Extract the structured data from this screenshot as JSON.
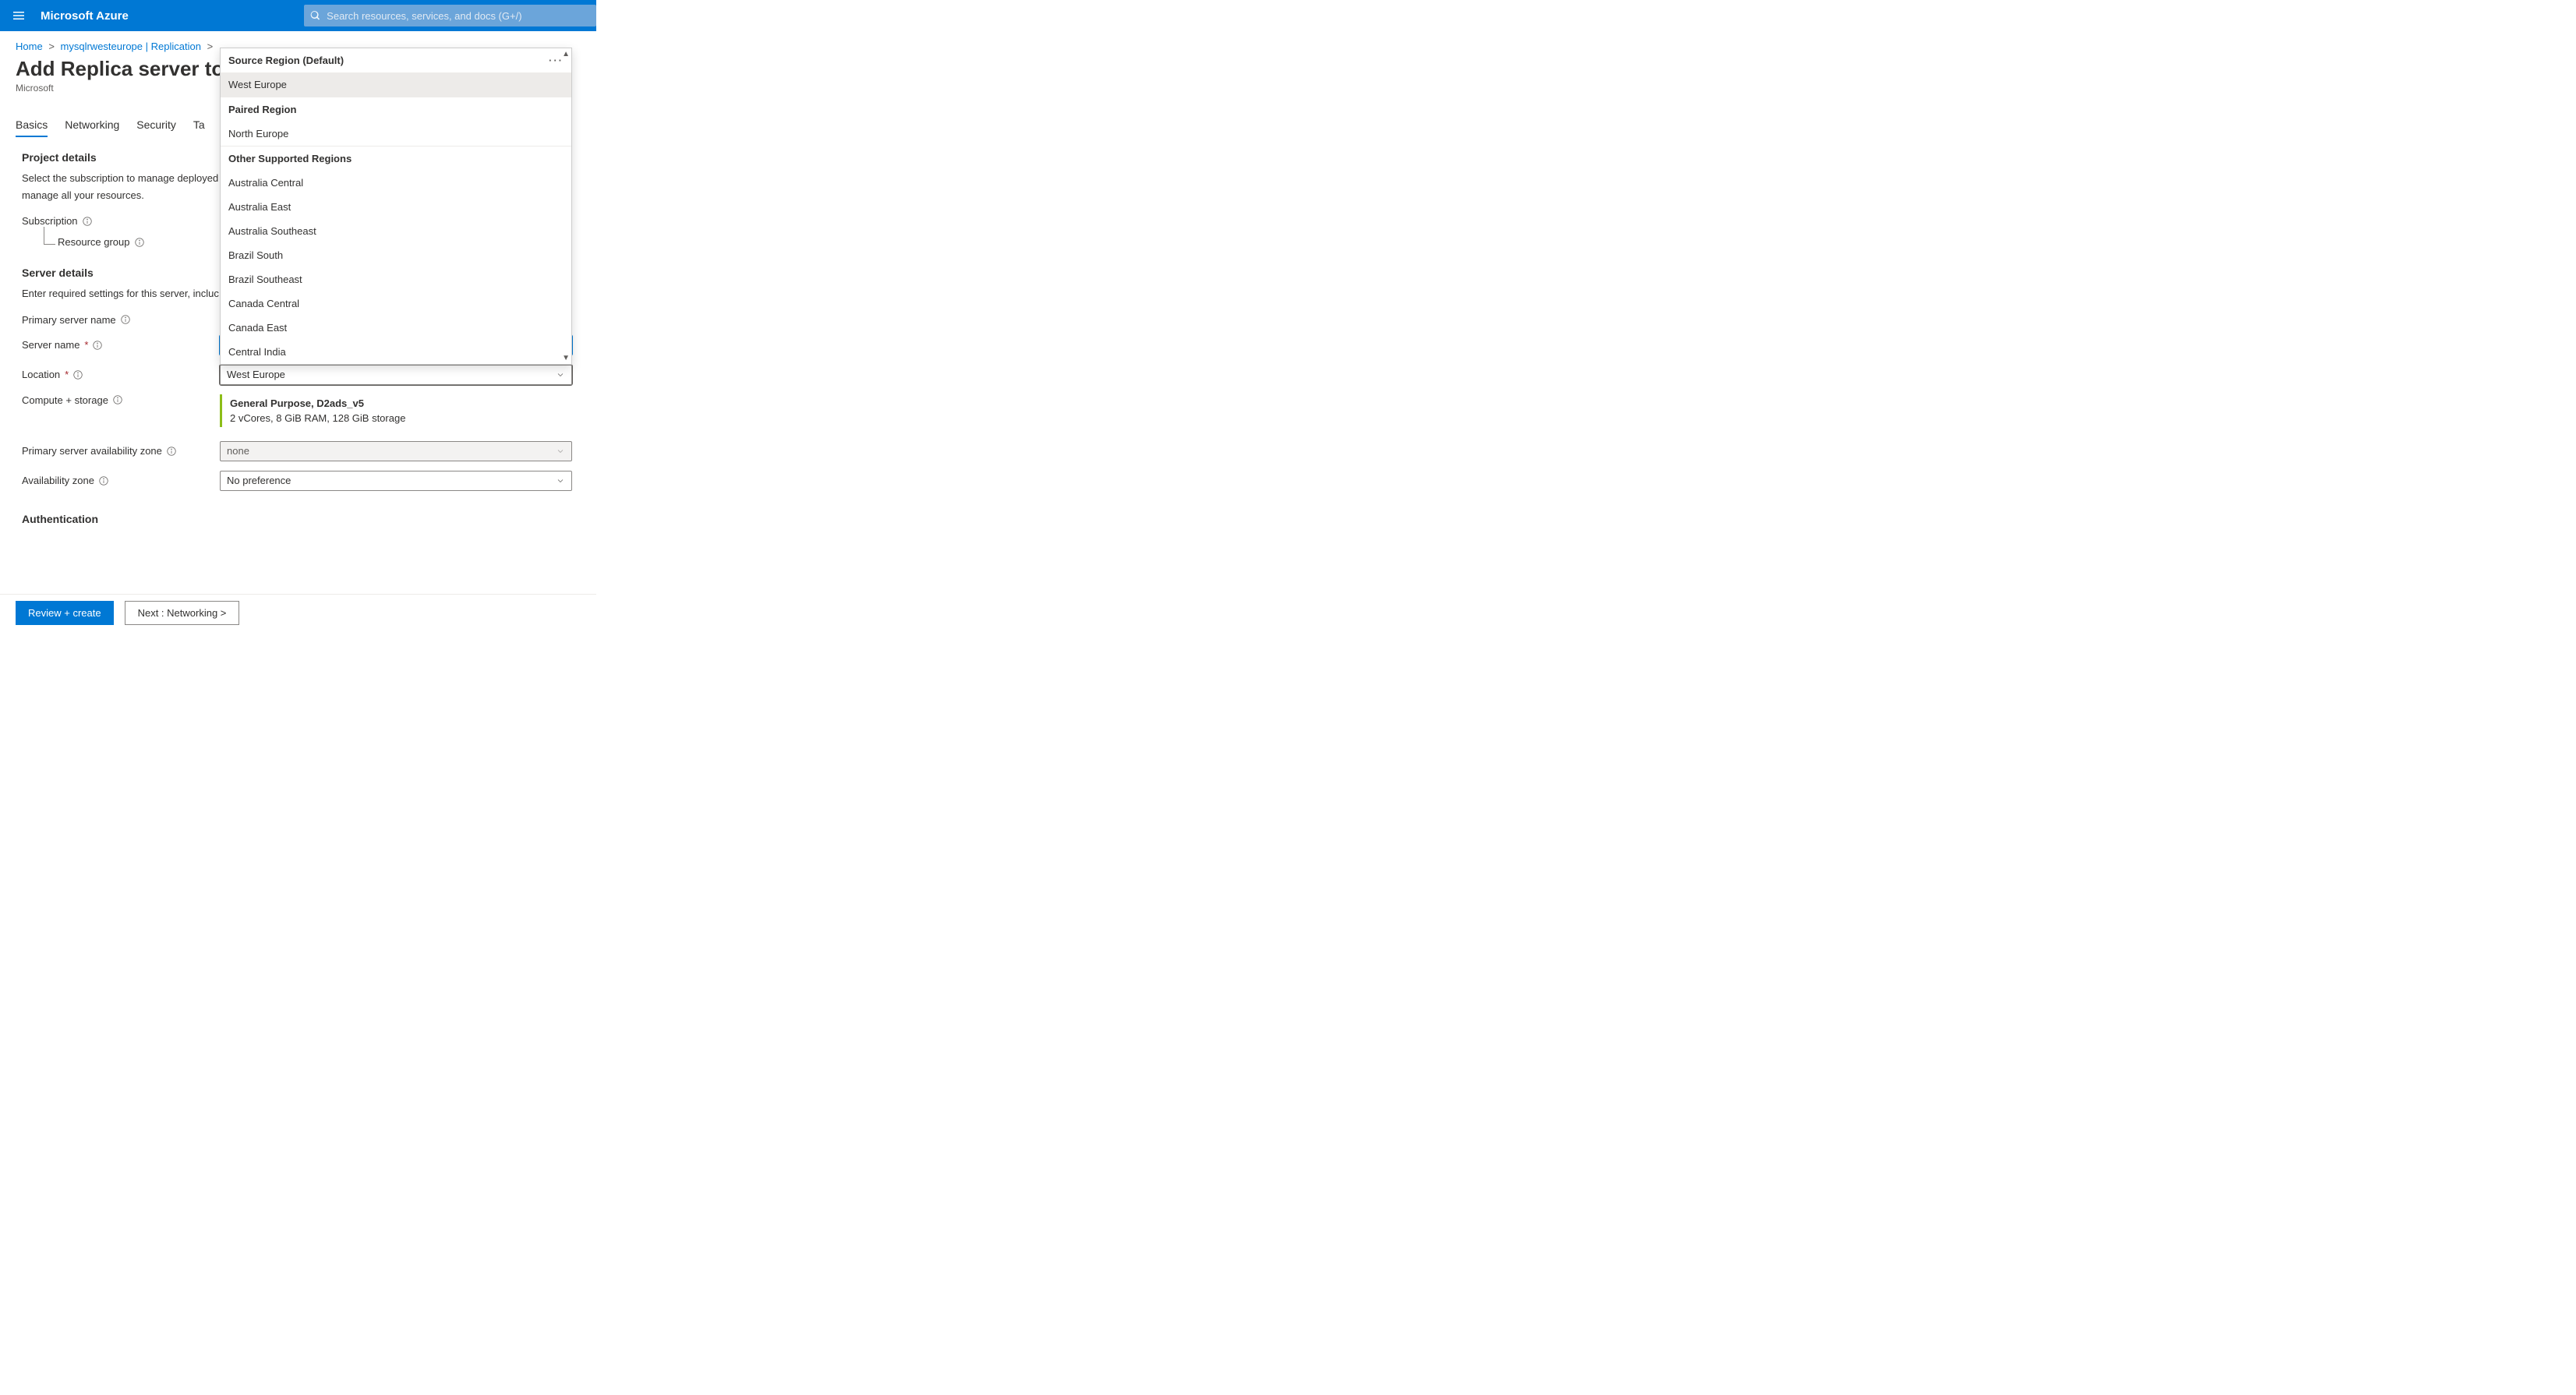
{
  "topbar": {
    "brand": "Microsoft Azure",
    "search_placeholder": "Search resources, services, and docs (G+/)"
  },
  "breadcrumb": {
    "items": [
      "Home",
      "mysqlrwesteurope | Replication"
    ]
  },
  "header": {
    "title": "Add Replica server to Az",
    "subtitle": "Microsoft"
  },
  "tabs": [
    "Basics",
    "Networking",
    "Security",
    "Ta"
  ],
  "project": {
    "section_title": "Project details",
    "section_desc": "Select the subscription to manage deployed resources and costs. Use resource groups like folders to organize and manage all your resources.",
    "section_desc_visible": "Select the subscription to manage deployed manage all your resources.",
    "subscription_label": "Subscription",
    "resource_group_label": "Resource group"
  },
  "server": {
    "section_title": "Server details",
    "section_desc": "Enter required settings for this server, incluc",
    "primary_name_label": "Primary server name",
    "server_name_label": "Server name",
    "server_name_value": "",
    "location_label": "Location",
    "location_value": "West Europe",
    "compute_label": "Compute + storage",
    "compute_title": "General Purpose, D2ads_v5",
    "compute_desc": "2 vCores, 8 GiB RAM, 128 GiB storage",
    "primary_az_label": "Primary server availability zone",
    "primary_az_value": "none",
    "az_label": "Availability zone",
    "az_value": "No preference"
  },
  "auth": {
    "section_title": "Authentication"
  },
  "dropdown": {
    "groups": [
      {
        "header": "Source Region (Default)",
        "has_ellipsis": true,
        "items": [
          "West Europe"
        ],
        "selected_index": 0
      },
      {
        "header": "Paired Region",
        "items": [
          "North Europe"
        ]
      },
      {
        "header": "Other Supported Regions",
        "items": [
          "Australia Central",
          "Australia East",
          "Australia Southeast",
          "Brazil South",
          "Brazil Southeast",
          "Canada Central",
          "Canada East",
          "Central India"
        ]
      }
    ]
  },
  "footer": {
    "review_label": "Review + create",
    "next_label": "Next : Networking  >"
  }
}
